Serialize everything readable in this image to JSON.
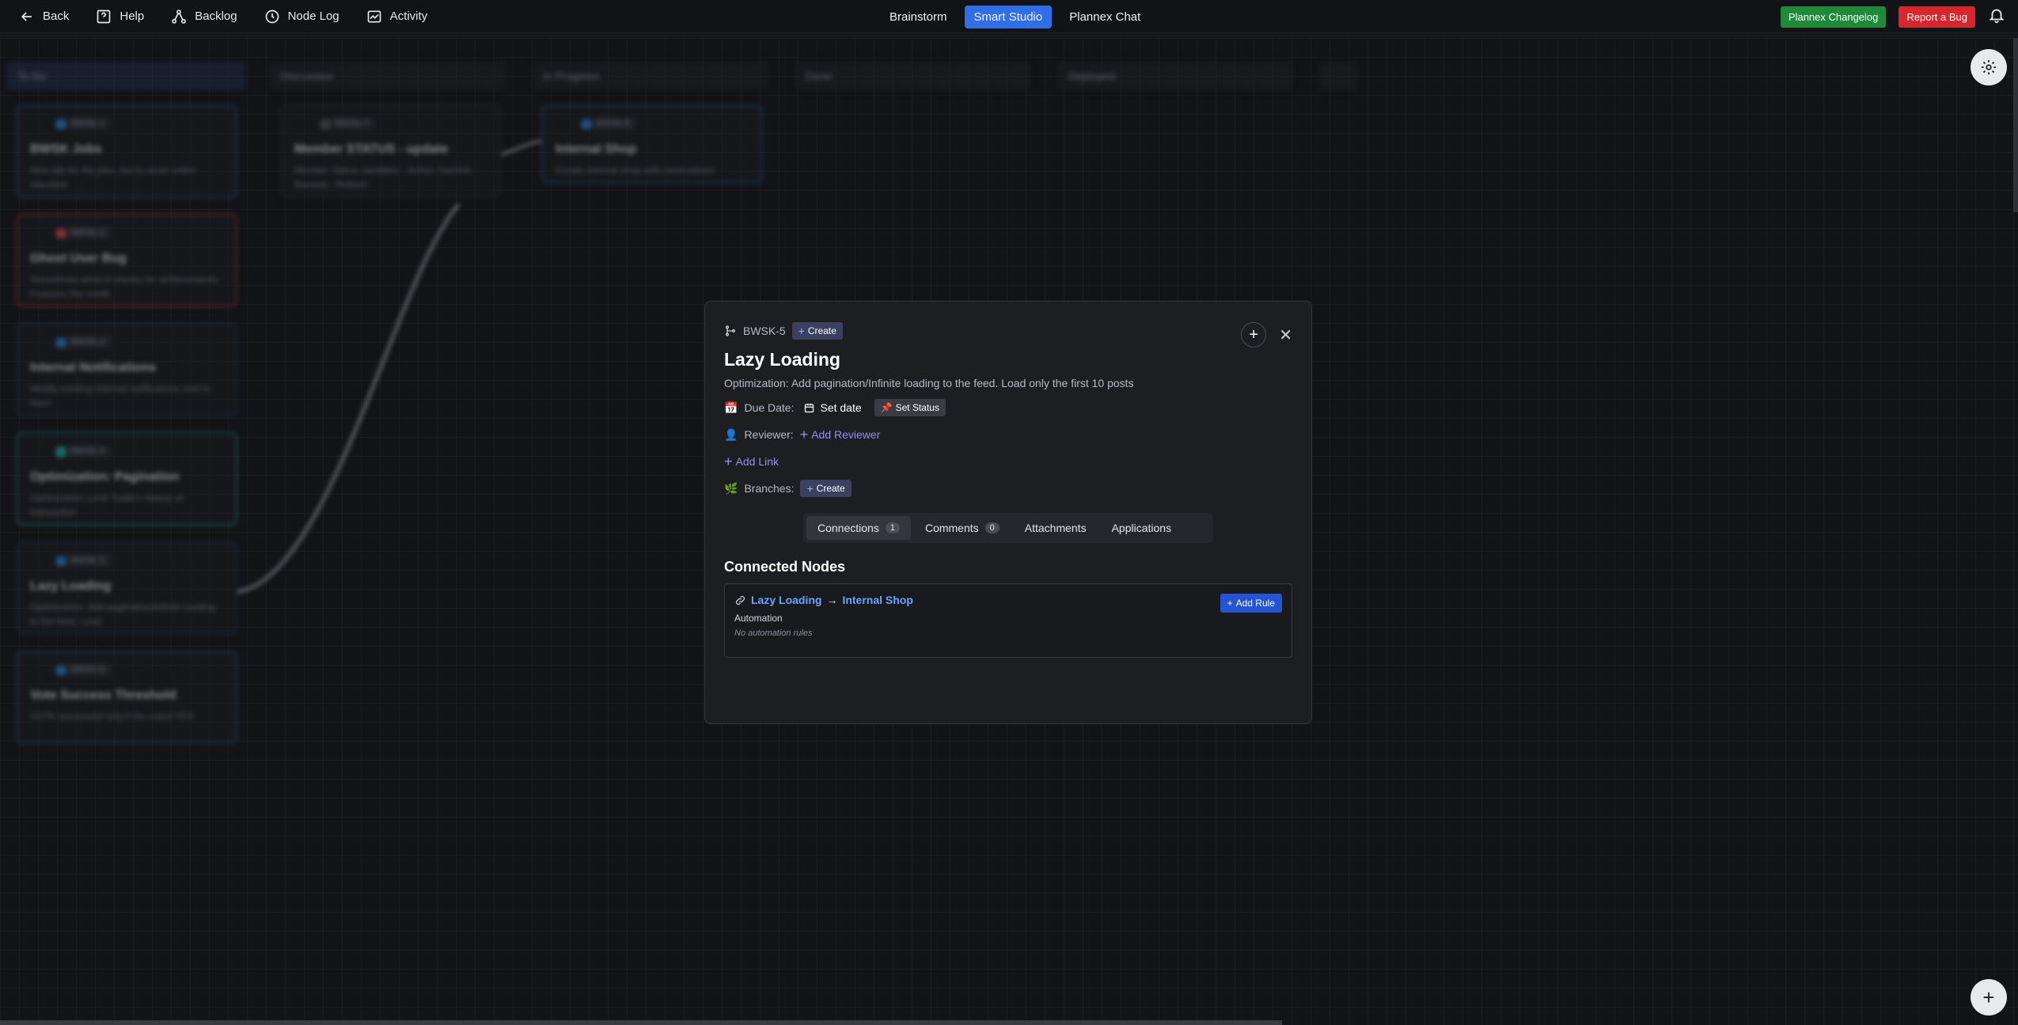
{
  "topnav": {
    "back": "Back",
    "help": "Help",
    "backlog": "Backlog",
    "node_log": "Node Log",
    "activity": "Activity",
    "tabs": [
      "Brainstorm",
      "Smart Studio",
      "Plannex Chat"
    ],
    "active_tab": "Smart Studio",
    "changelog": "Plannex Changelog",
    "report_bug": "Report a Bug"
  },
  "board": {
    "columns": [
      "To Do",
      "Discussion",
      "In Progress",
      "Done",
      "Deployed"
    ],
    "cards": [
      {
        "id": "BWSK-1",
        "title": "BWSK Jobs",
        "desc": "New tab for the jobs, but to cover entire standard"
      },
      {
        "id": "BWSK-2",
        "title": "Ghost User Bug",
        "desc": "Sometimes when it checks for achievements, it passes the credit"
      },
      {
        "id": "BWSK-3",
        "title": "Internal Notifications",
        "desc": "Modify existing internal notifications sent to them"
      },
      {
        "id": "BWSK-4",
        "title": "Optimization: Pagination",
        "desc": "Optimization: Limit Trade's history of transaction"
      },
      {
        "id": "BWSK-5",
        "title": "Lazy Loading",
        "desc": "Optimization: Add pagination/Infinite loading to the feed. Load"
      },
      {
        "id": "BWSK-6",
        "title": "Vote Success Threshold",
        "desc": "VOTE successful only if the voted YES"
      },
      {
        "id": "BWSK-7",
        "title": "Member STATUS - update",
        "desc": "Member Status variables - Active, Inactive - Banned - Retired"
      },
      {
        "id": "BWSK-8",
        "title": "Internal Shop",
        "desc": "Create internal shop with reservations"
      }
    ]
  },
  "modal": {
    "id": "BWSK-5",
    "create_label": "Create",
    "title": "Lazy Loading",
    "description": "Optimization: Add pagination/Infinite loading to the feed. Load only the first 10 posts",
    "due_label": "Due Date:",
    "set_date": "Set date",
    "set_status": "Set Status",
    "reviewer_label": "Reviewer:",
    "add_reviewer": "Add Reviewer",
    "add_link": "Add Link",
    "branches_label": "Branches:",
    "branches_create": "Create",
    "tabs": [
      {
        "label": "Connections",
        "count": "1"
      },
      {
        "label": "Comments",
        "count": "0"
      },
      {
        "label": "Attachments"
      },
      {
        "label": "Applications"
      }
    ],
    "section_title": "Connected Nodes",
    "connection": {
      "from": "Lazy Loading",
      "arrow": "→",
      "to": "Internal Shop",
      "add_rule": "Add Rule",
      "automation_label": "Automation",
      "automation_empty": "No automation rules"
    }
  }
}
